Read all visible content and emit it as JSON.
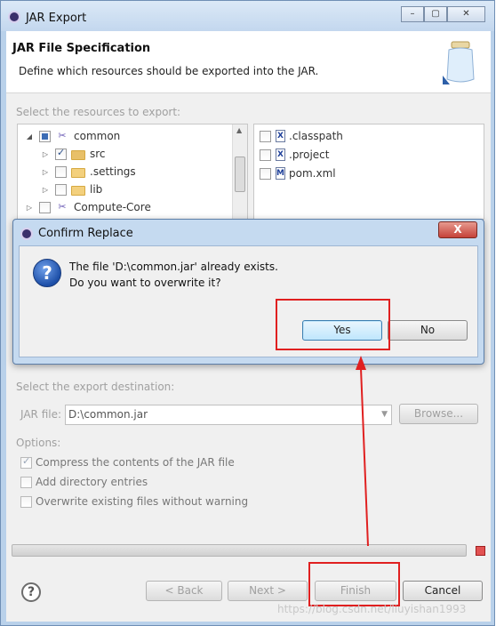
{
  "window": {
    "title": "JAR Export",
    "controls": [
      "minimize",
      "restore",
      "close"
    ]
  },
  "header": {
    "title": "JAR File Specification",
    "description": "Define which resources should be exported into the JAR."
  },
  "resources": {
    "label": "Select the resources to export:",
    "tree": [
      {
        "label": "common",
        "checkbox": "partial",
        "expanded": true,
        "icon": "project-icon"
      },
      {
        "label": "src",
        "checkbox": "checked",
        "icon": "package-folder-icon"
      },
      {
        "label": ".settings",
        "checkbox": "unchecked",
        "icon": "folder-icon"
      },
      {
        "label": "lib",
        "checkbox": "unchecked",
        "icon": "folder-icon"
      },
      {
        "label": "Compute-Core",
        "checkbox": "unchecked",
        "icon": "project-icon"
      }
    ],
    "files": [
      {
        "label": ".classpath",
        "checked": false,
        "icon": "xml-file-icon"
      },
      {
        "label": ".project",
        "checked": false,
        "icon": "xml-file-icon"
      },
      {
        "label": "pom.xml",
        "checked": false,
        "icon": "maven-file-icon"
      }
    ]
  },
  "confirm_dialog": {
    "title": "Confirm Replace",
    "close_label": "X",
    "message_line1": "The file 'D:\\common.jar' already exists.",
    "message_line2": "Do you want to overwrite it?",
    "yes_label": "Yes",
    "no_label": "No"
  },
  "destination": {
    "label": "Select the export destination:",
    "jar_file_label": "JAR file:",
    "jar_file_value": "D:\\common.jar",
    "browse_label": "Browse..."
  },
  "options": {
    "label": "Options:",
    "items": [
      {
        "label": "Compress the contents of the JAR file",
        "checked": true
      },
      {
        "label": "Add directory entries",
        "checked": false
      },
      {
        "label": "Overwrite existing files without warning",
        "checked": false
      }
    ]
  },
  "footer": {
    "help_label": "?",
    "back_label": "< Back",
    "next_label": "Next >",
    "finish_label": "Finish",
    "cancel_label": "Cancel"
  },
  "watermark": "https://blog.csdn.net/liuyishan1993",
  "colors": {
    "highlight": "#e02020",
    "title_bar": "#c3d7ee"
  }
}
